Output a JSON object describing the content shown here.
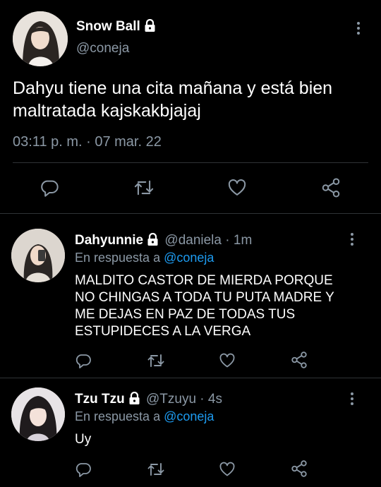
{
  "main_tweet": {
    "author_name": "Snow Ball",
    "author_handle": "@coneja",
    "text_line1": "Dahyu tiene una cita mañana y está bien",
    "text_line2": "maltratada kajskakbjajaj",
    "timestamp": "03:11 p. m. · 07 mar. 22"
  },
  "replies": [
    {
      "author_name": "Dahyunnie",
      "author_handle": "@daniela",
      "time": "· 1m",
      "reply_prefix": "En respuesta a",
      "reply_mention": "@coneja",
      "lines": [
        "MALDITO CASTOR DE MIERDA PORQUE",
        "NO CHINGAS A TODA TU PUTA MADRE Y",
        "ME DEJAS EN PAZ DE TODAS TUS",
        "ESTUPIDECES A LA VERGA"
      ]
    },
    {
      "author_name": "Tzu Tzu",
      "author_handle": "@Tzuyu",
      "time": "· 4s",
      "reply_prefix": "En respuesta a",
      "reply_mention": "@coneja",
      "lines": [
        "Uy"
      ]
    }
  ],
  "icons": [
    "lock-icon",
    "more-icon",
    "reply-icon",
    "retweet-icon",
    "like-icon",
    "share-icon"
  ],
  "colors": {
    "background": "#000000",
    "text": "#e7e9ea",
    "secondary": "#8b98a5",
    "mention": "#1d9bf0",
    "divider": "#2f3336"
  }
}
